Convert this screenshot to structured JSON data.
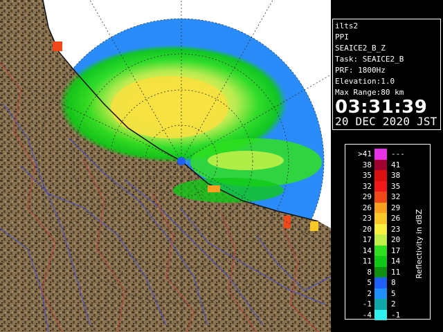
{
  "info": {
    "site": "ilts2",
    "product": "PPI",
    "scan": "SEAICE2_B_Z",
    "task": "Task: SEAICE2_B",
    "prf": "PRF: 1800Hz",
    "elevation": "Elevation:1.0",
    "max_range": "Max Range:80 km",
    "time": "03:31:39",
    "date": "20 DEC 2020 JST"
  },
  "legend": {
    "unit": "Reflectivity in dBZ",
    "rows": [
      {
        "min": ">41",
        "max": "---",
        "color": "#e832e6"
      },
      {
        "min": "38",
        "max": "41",
        "color": "#a00030"
      },
      {
        "min": "35",
        "max": "38",
        "color": "#d81010"
      },
      {
        "min": "32",
        "max": "35",
        "color": "#f01818"
      },
      {
        "min": "29",
        "max": "32",
        "color": "#f04818"
      },
      {
        "min": "26",
        "max": "29",
        "color": "#f8a020"
      },
      {
        "min": "23",
        "max": "26",
        "color": "#f8c828"
      },
      {
        "min": "20",
        "max": "23",
        "color": "#f8f040"
      },
      {
        "min": "17",
        "max": "20",
        "color": "#c0f048"
      },
      {
        "min": "14",
        "max": "17",
        "color": "#30e020"
      },
      {
        "min": "11",
        "max": "14",
        "color": "#10c818"
      },
      {
        "min": "8",
        "max": "11",
        "color": "#109010"
      },
      {
        "min": "5",
        "max": "8",
        "color": "#2060f8"
      },
      {
        "min": "2",
        "max": "5",
        "color": "#2090f8"
      },
      {
        "min": "-1",
        "max": "2",
        "color": "#10a8a8"
      },
      {
        "min": "-4",
        "max": "-1",
        "color": "#30f0f0"
      }
    ]
  },
  "colors": {
    "land": "#8a7350",
    "land_dark": "#4a3a28",
    "coverage": "#2a8cf8",
    "rivers": "#4a52d0",
    "boundaries": "#c04040"
  }
}
